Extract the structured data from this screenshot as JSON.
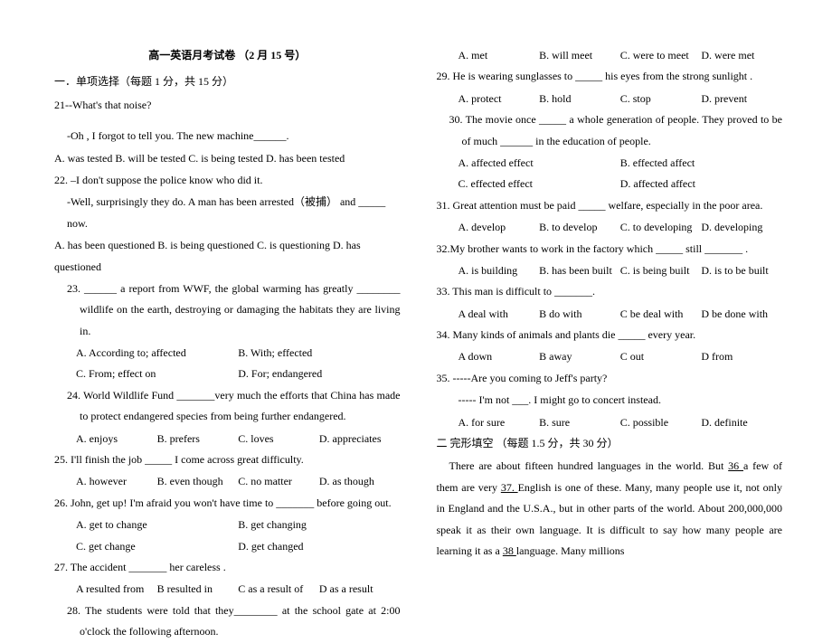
{
  "title": "高一英语月考试卷  （2 月 15 号）",
  "section1": "一．单项选择（每题 1 分，共 15 分）",
  "q21_a": "21--What's that noise?",
  "q21_b": "-Oh , I forgot to tell you. The new machine______.",
  "q21_opts": "A. was tested B. will be tested C. is being tested D. has been tested",
  "q22_a": "22. –I don't suppose the police know who did it.",
  "q22_b": "-Well, surprisingly they do. A man has been arrested（被捕）  and _____ now.",
  "q22_opts": " A. has been questioned B. is being questioned C. is questioning D. has questioned",
  "q23_a": "23.   ______ a report from WWF, the global warming has greatly ________ wildlife on the earth, destroying or damaging the habitats they are living in.",
  "q23_optA": "A. According to; affected",
  "q23_optB": "B. With; effected",
  "q23_optC": "C. From; effect on",
  "q23_optD": "D. For; endangered",
  "q24_a": "24.   World Wildlife Fund _______very much the efforts that China has made to protect endangered species from being further endangered.",
  "q24_optA": "A. enjoys",
  "q24_optB": "B. prefers",
  "q24_optC": "C. loves",
  "q24_optD": "D. appreciates",
  "q25_a": "25. I'll finish the job _____ I come across great difficulty.",
  "q25_optA": "A. however",
  "q25_optB": "B. even though",
  "q25_optC": "C. no matter",
  "q25_optD": "D. as though",
  "q26_a": "26. John, get up! I'm afraid you won't have time to _______ before going out.",
  "q26_optA": "A. get to change",
  "q26_optB": "B. get changing",
  "q26_optC": "C. get change",
  "q26_optD": "D. get changed",
  "q27_a": "27. The accident _______ her careless .",
  "q27_optA": "A resulted from",
  "q27_optB": "B resulted in",
  "q27_optC": "C as a result of",
  "q27_optD": "D as a result",
  "q28_a": "28. The students were told that they________ at the school gate at 2:00 o'clock the following afternoon.",
  "q28_optA": "A. met",
  "q28_optB": "B. will meet",
  "q28_optC": "C. were to meet",
  "q28_optD": "D. were met",
  "q29_a": "29. He is wearing sunglasses to _____ his eyes from the strong sunlight .",
  "q29_optA": "A. protect",
  "q29_optB": "B. hold",
  "q29_optC": "C. stop",
  "q29_optD": "D. prevent",
  "q30_a": "30. The movie once _____ a whole generation of people. They proved to be of much ______ in the education of people.",
  "q30_optA": "A. affected effect",
  "q30_optB": "B. effected affect",
  "q30_optC": "C. effected effect",
  "q30_optD": "D. affected affect",
  "q31_a": "31. Great attention must be paid _____ welfare, especially in the poor area.",
  "q31_optA": "A. develop",
  "q31_optB": "B. to develop",
  "q31_optC": "C. to developing",
  "q31_optD": "D. developing",
  "q32_a": "32.My brother wants to work in the factory which _____ still _______ .",
  "q32_optA": "A. is building",
  "q32_optB": "B. has been built",
  "q32_optC": "C.  is   being built",
  "q32_optD": "D. is to be built",
  "q33_a": "33. This man is difficult to _______.",
  "q33_optA": "A deal with",
  "q33_optB": "B do with",
  "q33_optC": "C be deal with",
  "q33_optD": "D be done with",
  "q34_a": "34. Many kinds of animals and plants die _____ every year.",
  "q34_optA": "A down",
  "q34_optB": "B away",
  "q34_optC": "C out",
  "q34_optD": "D from",
  "q35_a": "35. -----Are you coming to Jeff's party?",
  "q35_b": "----- I'm not ___. I might go to concert instead.",
  "q35_optA": "A. for sure",
  "q35_optB": "B. sure",
  "q35_optC": "C. possible",
  "q35_optD": "D. definite",
  "section2": "二  完形填空  （每题 1.5 分，共 30 分）",
  "cloze_p1a": "There are about fifteen hundred languages in the world. But ",
  "cloze_36": " 36 ",
  "cloze_p1b": "a few of them are very ",
  "cloze_37": " 37. ",
  "cloze_p1c": "English is one of these. Many, many people use it, not only in England and the U.S.A., but in other parts of the world. About 200,000,000 speak it as their own language. It is difficult to say how many people are learning it as a ",
  "cloze_38": " 38 ",
  "cloze_p1d": " language. Many millions"
}
